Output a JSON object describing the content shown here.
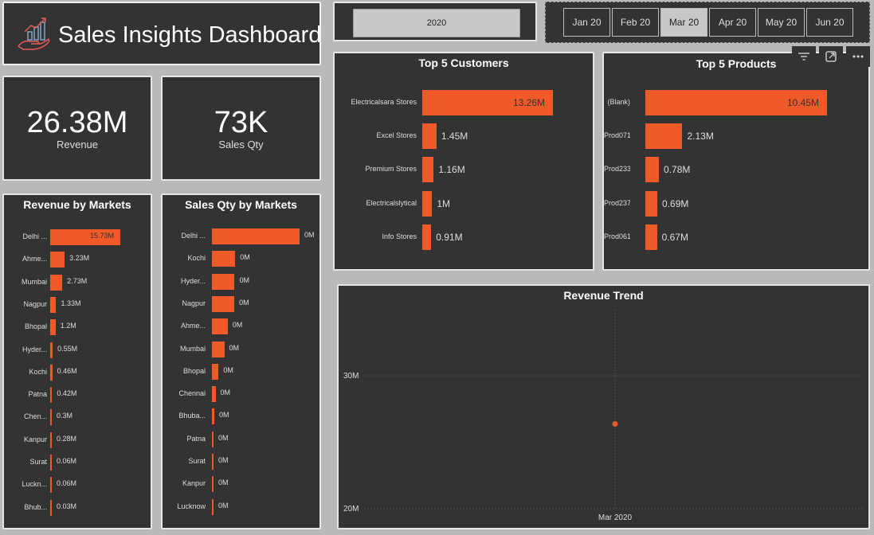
{
  "header": {
    "title": "Sales Insights Dashboard"
  },
  "year_slicer": {
    "selected": "2020"
  },
  "month_slicer": {
    "items": [
      "Jan 20",
      "Feb 20",
      "Mar 20",
      "Apr 20",
      "May 20",
      "Jun 20"
    ],
    "selected": "Mar 20"
  },
  "kpis": {
    "revenue": {
      "value": "26.38M",
      "label": "Revenue"
    },
    "sales_qty": {
      "value": "73K",
      "label": "Sales Qty"
    }
  },
  "colors": {
    "bar": "#f05a28",
    "panel": "#333333",
    "page": "#b9b9b9"
  },
  "visual_header_icons": [
    "filter-icon",
    "focus-mode-icon",
    "more-options-icon"
  ],
  "chart_data": [
    {
      "type": "bar",
      "orientation": "horizontal",
      "title": "Revenue by Markets",
      "categories": [
        "Delhi ...",
        "Ahme...",
        "Mumbai",
        "Nagpur",
        "Bhopal",
        "Hyder...",
        "Kochi",
        "Patna",
        "Chen...",
        "Kanpur",
        "Surat",
        "Luckn...",
        "Bhub..."
      ],
      "values": [
        15.73,
        3.23,
        2.73,
        1.33,
        1.2,
        0.55,
        0.46,
        0.42,
        0.3,
        0.28,
        0.06,
        0.06,
        0.03
      ],
      "labels": [
        "15.73M",
        "3.23M",
        "2.73M",
        "1.33M",
        "1.2M",
        "0.55M",
        "0.46M",
        "0.42M",
        "0.3M",
        "0.28M",
        "0.06M",
        "0.06M",
        "0.03M"
      ],
      "unit": "M"
    },
    {
      "type": "bar",
      "orientation": "horizontal",
      "title": "Sales Qty by Markets",
      "categories": [
        "Delhi ...",
        "Kochi",
        "Hyder...",
        "Nagpur",
        "Ahme...",
        "Mumbai",
        "Bhopal",
        "Chennai",
        "Bhuba...",
        "Patna",
        "Surat",
        "Kanpur",
        "Lucknow"
      ],
      "values": [
        0.029,
        0.0077,
        0.0075,
        0.0074,
        0.0052,
        0.0041,
        0.0022,
        0.0012,
        0.0008,
        0.0004,
        0.0003,
        0.0002,
        0.0001
      ],
      "labels": [
        "0M",
        "0M",
        "0M",
        "0M",
        "0M",
        "0M",
        "0M",
        "0M",
        "0M",
        "0M",
        "0M",
        "0M",
        "0M"
      ],
      "unit": "M"
    },
    {
      "type": "bar",
      "orientation": "horizontal",
      "title": "Top 5 Customers",
      "categories": [
        "Electricalsara Stores",
        "Excel Stores",
        "Premium Stores",
        "Electricalslytical",
        "Info Stores"
      ],
      "values": [
        13.26,
        1.45,
        1.16,
        1.0,
        0.91
      ],
      "labels": [
        "13.26M",
        "1.45M",
        "1.16M",
        "1M",
        "0.91M"
      ],
      "unit": "M"
    },
    {
      "type": "bar",
      "orientation": "horizontal",
      "title": "Top 5 Products",
      "categories": [
        "(Blank)",
        "Prod071",
        "Prod233",
        "Prod237",
        "Prod061"
      ],
      "values": [
        10.45,
        2.13,
        0.78,
        0.69,
        0.67
      ],
      "labels": [
        "10.45M",
        "2.13M",
        "0.78M",
        "0.69M",
        "0.67M"
      ],
      "unit": "M"
    },
    {
      "type": "line",
      "title": "Revenue Trend",
      "x": [
        "Mar 2020"
      ],
      "y": [
        26.38
      ],
      "y_ticks": [
        "30M",
        "20M"
      ],
      "y_tick_values": [
        30,
        20
      ],
      "ylim": [
        20,
        30
      ],
      "grid": true
    }
  ]
}
